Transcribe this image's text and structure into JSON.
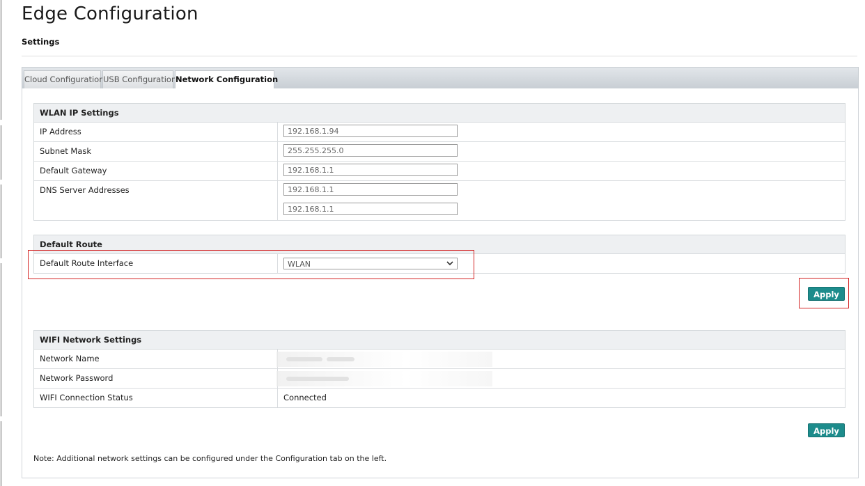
{
  "page": {
    "title": "Edge Configuration",
    "subtitle": "Settings"
  },
  "tabs": [
    {
      "label": "Cloud Configuration",
      "active": false
    },
    {
      "label": "USB Configuration",
      "active": false
    },
    {
      "label": "Network Configuration",
      "active": true
    }
  ],
  "wlan": {
    "heading": "WLAN IP Settings",
    "ip_label": "IP Address",
    "ip_value": "192.168.1.94",
    "subnet_label": "Subnet Mask",
    "subnet_value": "255.255.255.0",
    "gateway_label": "Default Gateway",
    "gateway_value": "192.168.1.1",
    "dns_label": "DNS Server Addresses",
    "dns1_value": "192.168.1.1",
    "dns2_value": "192.168.1.1"
  },
  "route": {
    "heading": "Default Route",
    "interface_label": "Default Route Interface",
    "interface_value": "WLAN",
    "apply_label": "Apply"
  },
  "wifi": {
    "heading": "WIFI Network Settings",
    "name_label": "Network Name",
    "password_label": "Network Password",
    "status_label": "WIFI Connection Status",
    "status_value": "Connected",
    "apply_label": "Apply"
  },
  "note": "Note: Additional network settings can be configured under the Configuration tab on the left.",
  "colors": {
    "apply_button": "#1d8c8c",
    "highlight": "#d32424",
    "section_header": "#eef0f2"
  },
  "icons": {
    "select_chevron": "chevron-down-icon"
  }
}
